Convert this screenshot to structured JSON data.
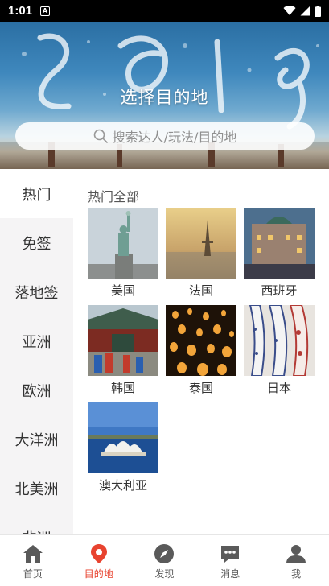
{
  "status_bar": {
    "time": "1:01",
    "notification": "A"
  },
  "hero": {
    "title": "选择目的地",
    "search_placeholder": "搜索达人/玩法/目的地"
  },
  "sidebar": {
    "items": [
      {
        "label": "热门",
        "active": true
      },
      {
        "label": "免签"
      },
      {
        "label": "落地签"
      },
      {
        "label": "亚洲"
      },
      {
        "label": "欧洲"
      },
      {
        "label": "大洋洲"
      },
      {
        "label": "北美洲"
      },
      {
        "label": "非洲"
      }
    ]
  },
  "content": {
    "section_title": "热门全部",
    "destinations": [
      {
        "label": "美国",
        "icon": "statue-of-liberty-image"
      },
      {
        "label": "法国",
        "icon": "eiffel-tower-image"
      },
      {
        "label": "西班牙",
        "icon": "madrid-street-image"
      },
      {
        "label": "韩国",
        "icon": "korean-palace-image"
      },
      {
        "label": "泰国",
        "icon": "sky-lanterns-image"
      },
      {
        "label": "日本",
        "icon": "koi-kites-image"
      },
      {
        "label": "澳大利亚",
        "icon": "sydney-opera-house-image"
      }
    ]
  },
  "bottom_nav": {
    "items": [
      {
        "label": "首页",
        "icon": "home-icon"
      },
      {
        "label": "目的地",
        "icon": "location-pin-icon",
        "active": true
      },
      {
        "label": "发现",
        "icon": "compass-icon"
      },
      {
        "label": "消息",
        "icon": "chat-icon"
      },
      {
        "label": "我",
        "icon": "person-icon"
      }
    ]
  },
  "colors": {
    "accent": "#e8432f",
    "sidebar_bg": "#f5f4f5",
    "status_bar": "#000000"
  }
}
